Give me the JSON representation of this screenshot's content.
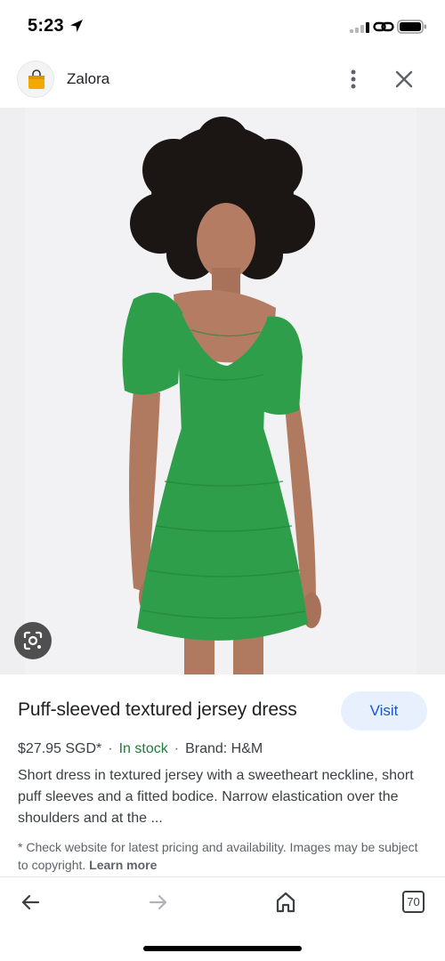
{
  "status_bar": {
    "time": "5:23",
    "icons": [
      "location-arrow-icon",
      "signal-icon",
      "link-icon",
      "battery-icon"
    ]
  },
  "header": {
    "site_name": "Zalora",
    "logo_icon": "shopping-bag-icon",
    "more_icon": "more-vertical-icon",
    "close_icon": "close-icon"
  },
  "image": {
    "alt": "Woman wearing a green puff-sleeved textured jersey dress",
    "lens_icon": "google-lens-icon"
  },
  "product": {
    "title": "Puff-sleeved textured jersey dress",
    "visit_label": "Visit",
    "price": "$27.95 SGD*",
    "separator": "·",
    "stock": "In stock",
    "brand": "Brand: H&M",
    "description": "Short dress in textured jersey with a sweetheart neckline, short puff sleeves and a fitted bodice. Narrow elastication over the shoulders and at the ...",
    "disclaimer": "* Check website for latest pricing and availability. Images may be subject to copyright.",
    "learn_more": "Learn more"
  },
  "bottom_nav": {
    "tab_count": "70",
    "icons": [
      "back-arrow-icon",
      "forward-arrow-icon",
      "home-icon",
      "tabs-icon"
    ]
  },
  "colors": {
    "accent": "#1a56c4",
    "visit_bg": "#e8f0fe",
    "in_stock": "#188038",
    "dress": "#2e9e4a",
    "image_bg": "#efeff1"
  }
}
